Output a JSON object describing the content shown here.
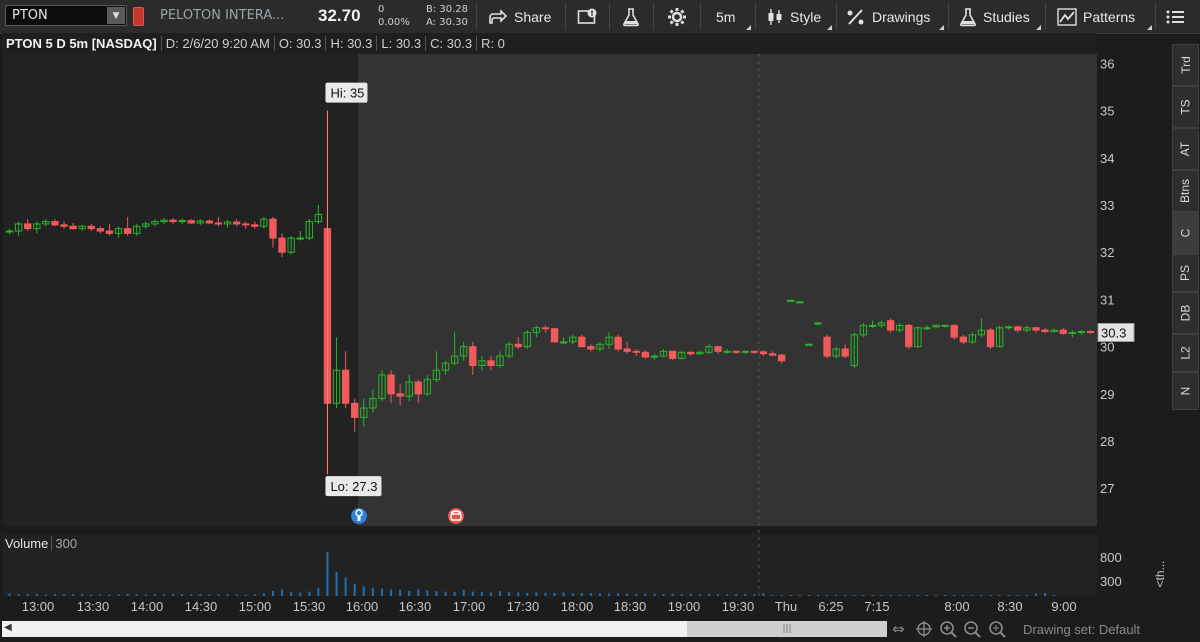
{
  "toolbar": {
    "symbol": "PTON",
    "dropdown_glyph": "▼",
    "company": "PELOTON INTERA...",
    "price": "32.70",
    "change": "0",
    "change_pct": "0.00%",
    "bid": "B: 30.28",
    "ask": "A: 30.30",
    "share_label": "Share",
    "timeframe_label": "5m",
    "style_label": "Style",
    "drawings_label": "Drawings",
    "studies_label": "Studies",
    "patterns_label": "Patterns",
    "icons": [
      "share-icon",
      "alert-icon",
      "flask-icon",
      "gear-icon",
      "candlestick-icon",
      "drawings-icon",
      "studies-flask-icon",
      "patterns-icon",
      "menu-icon"
    ]
  },
  "chart_header": {
    "title": "PTON 5 D 5m [NASDAQ]",
    "date": "D: 2/6/20 9:20 AM",
    "open": "O: 30.3",
    "high": "H: 30.3",
    "low": "L: 30.3",
    "close": "C: 30.3",
    "range": "R: 0"
  },
  "side_tabs": [
    "Trd",
    "TS",
    "AT",
    "Btns",
    "C",
    "PS",
    "DB",
    "L2",
    "N"
  ],
  "volume": {
    "label": "Volume",
    "value": "300",
    "axis_labels": [
      "800",
      "300"
    ]
  },
  "expand_label": "<th...",
  "bottom": {
    "drawing_set": "Drawing set: Default",
    "scroll_glyph": "◀",
    "thumb_glyph": "|||"
  },
  "chart_data": {
    "type": "candlestick",
    "symbol": "PTON",
    "interval": "5m",
    "ylim": [
      26.2,
      36.2
    ],
    "y_ticks": [
      36,
      35,
      34,
      33,
      32,
      31,
      30,
      29,
      28,
      27
    ],
    "x_ticks": [
      "13:00",
      "13:30",
      "14:00",
      "14:30",
      "15:00",
      "15:30",
      "16:00",
      "16:30",
      "17:00",
      "17:30",
      "18:00",
      "18:30",
      "19:00",
      "19:30",
      "Thu",
      "6:25",
      "7:15",
      "8:00",
      "8:30",
      "9:00"
    ],
    "last_price_label": "30.3",
    "hi_label": "Hi: 35",
    "lo_label": "Lo: 27.3",
    "colors": {
      "up": "#2bb52b",
      "down": "#f05a5a",
      "volume": "#1f6fb5",
      "axis_text": "#c8c8c8",
      "background": "#333333",
      "premarket": "#222222"
    },
    "candles": [
      {
        "o": 32.43,
        "h": 32.5,
        "l": 32.38,
        "c": 32.45
      },
      {
        "o": 32.45,
        "h": 32.65,
        "l": 32.35,
        "c": 32.6
      },
      {
        "o": 32.6,
        "h": 32.7,
        "l": 32.45,
        "c": 32.5
      },
      {
        "o": 32.5,
        "h": 32.65,
        "l": 32.4,
        "c": 32.6
      },
      {
        "o": 32.6,
        "h": 32.7,
        "l": 32.55,
        "c": 32.65
      },
      {
        "o": 32.65,
        "h": 32.7,
        "l": 32.55,
        "c": 32.58
      },
      {
        "o": 32.58,
        "h": 32.65,
        "l": 32.5,
        "c": 32.55
      },
      {
        "o": 32.55,
        "h": 32.62,
        "l": 32.48,
        "c": 32.5
      },
      {
        "o": 32.5,
        "h": 32.58,
        "l": 32.45,
        "c": 32.55
      },
      {
        "o": 32.55,
        "h": 32.6,
        "l": 32.45,
        "c": 32.5
      },
      {
        "o": 32.5,
        "h": 32.55,
        "l": 32.4,
        "c": 32.45
      },
      {
        "o": 32.45,
        "h": 32.6,
        "l": 32.35,
        "c": 32.4
      },
      {
        "o": 32.4,
        "h": 32.55,
        "l": 32.3,
        "c": 32.5
      },
      {
        "o": 32.5,
        "h": 32.75,
        "l": 32.35,
        "c": 32.4
      },
      {
        "o": 32.4,
        "h": 32.6,
        "l": 32.35,
        "c": 32.55
      },
      {
        "o": 32.55,
        "h": 32.65,
        "l": 32.5,
        "c": 32.6
      },
      {
        "o": 32.6,
        "h": 32.7,
        "l": 32.55,
        "c": 32.65
      },
      {
        "o": 32.65,
        "h": 32.72,
        "l": 32.6,
        "c": 32.68
      },
      {
        "o": 32.68,
        "h": 32.72,
        "l": 32.6,
        "c": 32.65
      },
      {
        "o": 32.65,
        "h": 32.72,
        "l": 32.6,
        "c": 32.67
      },
      {
        "o": 32.67,
        "h": 32.7,
        "l": 32.6,
        "c": 32.62
      },
      {
        "o": 32.62,
        "h": 32.7,
        "l": 32.58,
        "c": 32.66
      },
      {
        "o": 32.66,
        "h": 32.7,
        "l": 32.6,
        "c": 32.62
      },
      {
        "o": 32.62,
        "h": 32.75,
        "l": 32.55,
        "c": 32.6
      },
      {
        "o": 32.6,
        "h": 32.68,
        "l": 32.52,
        "c": 32.64
      },
      {
        "o": 32.64,
        "h": 32.7,
        "l": 32.55,
        "c": 32.6
      },
      {
        "o": 32.6,
        "h": 32.65,
        "l": 32.5,
        "c": 32.58
      },
      {
        "o": 32.58,
        "h": 32.65,
        "l": 32.5,
        "c": 32.55
      },
      {
        "o": 32.55,
        "h": 32.75,
        "l": 32.5,
        "c": 32.7
      },
      {
        "o": 32.7,
        "h": 32.75,
        "l": 32.1,
        "c": 32.3
      },
      {
        "o": 32.3,
        "h": 32.4,
        "l": 31.9,
        "c": 32.0
      },
      {
        "o": 32.0,
        "h": 32.35,
        "l": 31.95,
        "c": 32.3
      },
      {
        "o": 32.3,
        "h": 32.45,
        "l": 32.25,
        "c": 32.3
      },
      {
        "o": 32.3,
        "h": 32.7,
        "l": 32.25,
        "c": 32.65
      },
      {
        "o": 32.65,
        "h": 33.0,
        "l": 32.6,
        "c": 32.8
      },
      {
        "o": 32.5,
        "h": 35.0,
        "l": 27.3,
        "c": 28.8
      },
      {
        "o": 28.8,
        "h": 30.2,
        "l": 28.7,
        "c": 29.5
      },
      {
        "o": 29.5,
        "h": 29.9,
        "l": 28.7,
        "c": 28.8
      },
      {
        "o": 28.8,
        "h": 28.9,
        "l": 28.2,
        "c": 28.5
      },
      {
        "o": 28.5,
        "h": 28.9,
        "l": 28.3,
        "c": 28.7
      },
      {
        "o": 28.7,
        "h": 29.1,
        "l": 28.6,
        "c": 28.9
      },
      {
        "o": 28.9,
        "h": 29.5,
        "l": 28.85,
        "c": 29.4
      },
      {
        "o": 29.4,
        "h": 29.5,
        "l": 28.8,
        "c": 29.0
      },
      {
        "o": 29.0,
        "h": 29.2,
        "l": 28.75,
        "c": 28.95
      },
      {
        "o": 28.95,
        "h": 29.4,
        "l": 28.85,
        "c": 29.25
      },
      {
        "o": 29.25,
        "h": 29.3,
        "l": 28.8,
        "c": 29.0
      },
      {
        "o": 29.0,
        "h": 29.4,
        "l": 28.95,
        "c": 29.3
      },
      {
        "o": 29.3,
        "h": 29.9,
        "l": 29.25,
        "c": 29.5
      },
      {
        "o": 29.5,
        "h": 29.7,
        "l": 29.4,
        "c": 29.65
      },
      {
        "o": 29.65,
        "h": 30.3,
        "l": 29.6,
        "c": 29.8
      },
      {
        "o": 29.8,
        "h": 30.1,
        "l": 29.7,
        "c": 30.0
      },
      {
        "o": 30.0,
        "h": 30.1,
        "l": 29.4,
        "c": 29.6
      },
      {
        "o": 29.6,
        "h": 29.8,
        "l": 29.5,
        "c": 29.7
      },
      {
        "o": 29.7,
        "h": 29.8,
        "l": 29.5,
        "c": 29.6
      },
      {
        "o": 29.6,
        "h": 29.9,
        "l": 29.55,
        "c": 29.8
      },
      {
        "o": 29.8,
        "h": 30.1,
        "l": 29.75,
        "c": 30.05
      },
      {
        "o": 30.05,
        "h": 30.2,
        "l": 29.95,
        "c": 30.0
      },
      {
        "o": 30.0,
        "h": 30.35,
        "l": 29.95,
        "c": 30.3
      },
      {
        "o": 30.3,
        "h": 30.45,
        "l": 30.2,
        "c": 30.4
      },
      {
        "o": 30.4,
        "h": 30.45,
        "l": 30.3,
        "c": 30.38
      },
      {
        "o": 30.38,
        "h": 30.4,
        "l": 30.1,
        "c": 30.1
      },
      {
        "o": 30.1,
        "h": 30.2,
        "l": 30.05,
        "c": 30.1
      },
      {
        "o": 30.1,
        "h": 30.25,
        "l": 30.05,
        "c": 30.2
      },
      {
        "o": 30.2,
        "h": 30.25,
        "l": 30.0,
        "c": 30.0
      },
      {
        "o": 30.0,
        "h": 30.05,
        "l": 29.9,
        "c": 29.95
      },
      {
        "o": 29.95,
        "h": 30.1,
        "l": 29.9,
        "c": 30.05
      },
      {
        "o": 30.05,
        "h": 30.3,
        "l": 29.95,
        "c": 30.2
      },
      {
        "o": 30.2,
        "h": 30.25,
        "l": 29.9,
        "c": 29.95
      },
      {
        "o": 29.95,
        "h": 30.1,
        "l": 29.85,
        "c": 29.9
      },
      {
        "o": 29.9,
        "h": 29.95,
        "l": 29.8,
        "c": 29.88
      },
      {
        "o": 29.88,
        "h": 29.92,
        "l": 29.75,
        "c": 29.78
      },
      {
        "o": 29.78,
        "h": 29.85,
        "l": 29.72,
        "c": 29.8
      },
      {
        "o": 29.8,
        "h": 29.95,
        "l": 29.78,
        "c": 29.9
      },
      {
        "o": 29.9,
        "h": 29.92,
        "l": 29.72,
        "c": 29.75
      },
      {
        "o": 29.75,
        "h": 29.9,
        "l": 29.73,
        "c": 29.88
      },
      {
        "o": 29.88,
        "h": 29.9,
        "l": 29.8,
        "c": 29.85
      },
      {
        "o": 29.85,
        "h": 29.92,
        "l": 29.82,
        "c": 29.88
      },
      {
        "o": 29.88,
        "h": 30.05,
        "l": 29.85,
        "c": 30.0
      },
      {
        "o": 30.0,
        "h": 30.02,
        "l": 29.85,
        "c": 29.9
      },
      {
        "o": 29.9,
        "h": 29.95,
        "l": 29.85,
        "c": 29.9
      },
      {
        "o": 29.9,
        "h": 29.92,
        "l": 29.85,
        "c": 29.88
      },
      {
        "o": 29.88,
        "h": 29.92,
        "l": 29.85,
        "c": 29.9
      },
      {
        "o": 29.9,
        "h": 29.92,
        "l": 29.85,
        "c": 29.89
      },
      {
        "o": 29.89,
        "h": 29.92,
        "l": 29.8,
        "c": 29.85
      },
      {
        "o": 29.85,
        "h": 29.9,
        "l": 29.8,
        "c": 29.82
      },
      {
        "o": 29.82,
        "h": 29.85,
        "l": 29.65,
        "c": 29.7
      },
      {
        "o": 30.98,
        "h": 31.0,
        "l": 30.97,
        "c": 30.98
      },
      {
        "o": 30.95,
        "h": 30.96,
        "l": 30.94,
        "c": 30.95
      },
      {
        "o": 30.05,
        "h": 30.07,
        "l": 30.04,
        "c": 30.05
      },
      {
        "o": 30.5,
        "h": 30.52,
        "l": 30.45,
        "c": 30.5
      },
      {
        "o": 30.2,
        "h": 30.25,
        "l": 29.75,
        "c": 29.8
      },
      {
        "o": 29.8,
        "h": 30.0,
        "l": 29.75,
        "c": 29.95
      },
      {
        "o": 29.95,
        "h": 30.05,
        "l": 29.75,
        "c": 29.8
      },
      {
        "o": 29.6,
        "h": 30.3,
        "l": 29.55,
        "c": 30.25
      },
      {
        "o": 30.25,
        "h": 30.5,
        "l": 30.2,
        "c": 30.45
      },
      {
        "o": 30.45,
        "h": 30.55,
        "l": 30.4,
        "c": 30.45
      },
      {
        "o": 30.45,
        "h": 30.55,
        "l": 30.4,
        "c": 30.5
      },
      {
        "o": 30.55,
        "h": 30.6,
        "l": 30.3,
        "c": 30.35
      },
      {
        "o": 30.35,
        "h": 30.5,
        "l": 30.3,
        "c": 30.45
      },
      {
        "o": 30.45,
        "h": 30.48,
        "l": 29.95,
        "c": 30.0
      },
      {
        "o": 30.0,
        "h": 30.42,
        "l": 29.98,
        "c": 30.4
      },
      {
        "o": 30.4,
        "h": 30.45,
        "l": 30.35,
        "c": 30.4
      },
      {
        "o": 30.42,
        "h": 30.47,
        "l": 30.38,
        "c": 30.45
      },
      {
        "o": 30.45,
        "h": 30.47,
        "l": 30.4,
        "c": 30.45
      },
      {
        "o": 30.45,
        "h": 30.48,
        "l": 30.15,
        "c": 30.2
      },
      {
        "o": 30.2,
        "h": 30.25,
        "l": 30.05,
        "c": 30.1
      },
      {
        "o": 30.1,
        "h": 30.3,
        "l": 30.05,
        "c": 30.25
      },
      {
        "o": 30.25,
        "h": 30.6,
        "l": 30.2,
        "c": 30.35
      },
      {
        "o": 30.35,
        "h": 30.4,
        "l": 29.95,
        "c": 30.0
      },
      {
        "o": 30.0,
        "h": 30.45,
        "l": 29.98,
        "c": 30.4
      },
      {
        "o": 30.4,
        "h": 30.45,
        "l": 30.35,
        "c": 30.42
      },
      {
        "o": 30.42,
        "h": 30.45,
        "l": 30.3,
        "c": 30.35
      },
      {
        "o": 30.35,
        "h": 30.45,
        "l": 30.3,
        "c": 30.4
      },
      {
        "o": 30.4,
        "h": 30.42,
        "l": 30.3,
        "c": 30.35
      },
      {
        "o": 30.35,
        "h": 30.4,
        "l": 30.28,
        "c": 30.32
      },
      {
        "o": 30.32,
        "h": 30.38,
        "l": 30.3,
        "c": 30.35
      },
      {
        "o": 30.35,
        "h": 30.4,
        "l": 30.25,
        "c": 30.28
      },
      {
        "o": 30.28,
        "h": 30.35,
        "l": 30.2,
        "c": 30.3
      },
      {
        "o": 30.3,
        "h": 30.35,
        "l": 30.25,
        "c": 30.32
      },
      {
        "o": 30.32,
        "h": 30.35,
        "l": 30.28,
        "c": 30.3
      }
    ],
    "volumes": [
      60,
      40,
      50,
      45,
      30,
      40,
      35,
      40,
      45,
      30,
      35,
      30,
      40,
      50,
      35,
      30,
      40,
      35,
      40,
      45,
      35,
      40,
      30,
      35,
      40,
      35,
      30,
      40,
      60,
      120,
      150,
      90,
      80,
      100,
      180,
      1000,
      550,
      420,
      280,
      220,
      190,
      170,
      150,
      140,
      120,
      150,
      130,
      110,
      100,
      90,
      140,
      100,
      90,
      80,
      110,
      90,
      80,
      70,
      80,
      75,
      70,
      80,
      60,
      70,
      65,
      60,
      55,
      60,
      55,
      50,
      55,
      50,
      45,
      50,
      45,
      50,
      40,
      45,
      40,
      35,
      40,
      45,
      40,
      60,
      10,
      10,
      10,
      10,
      20,
      15,
      10,
      25,
      20,
      15,
      10,
      15,
      10,
      20,
      15,
      10,
      10,
      10,
      10,
      15,
      10,
      15,
      10,
      10,
      15,
      10,
      10,
      10,
      10,
      60,
      70,
      15
    ],
    "premarket_end_index": 34.5,
    "day_separator_index": 82.5
  }
}
